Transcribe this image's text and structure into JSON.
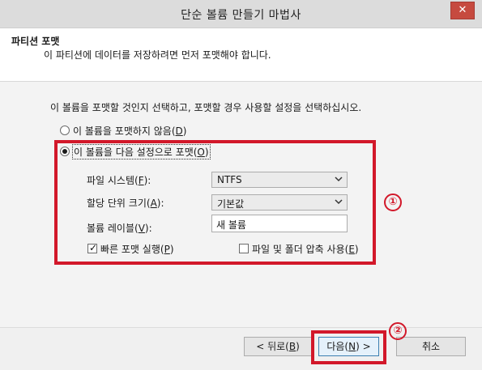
{
  "window": {
    "title": "단순 볼륨 만들기 마법사",
    "close_glyph": "✕"
  },
  "header": {
    "title": "파티션 포맷",
    "subtitle": "이 파티션에 데이터를 저장하려면 먼저 포맷해야 합니다."
  },
  "main": {
    "instruction": "이 볼륨을 포맷할 것인지 선택하고, 포맷할 경우 사용할 설정을 선택하십시오.",
    "option_no_format": {
      "label": "이 볼륨을 포맷하지 않음(",
      "key": "D",
      "tail": ")",
      "selected": false
    },
    "option_format": {
      "label": "이 볼륨을 다음 설정으로 포맷(",
      "key": "O",
      "tail": ")",
      "selected": true
    },
    "file_system": {
      "label": "파일 시스템(",
      "key": "F",
      "tail": "):",
      "value": "NTFS"
    },
    "allocation_unit": {
      "label": "할당 단위 크기(",
      "key": "A",
      "tail": "):",
      "value": "기본값"
    },
    "volume_label": {
      "label": "볼륨 레이블(",
      "key": "V",
      "tail": "):",
      "value": "새 볼륨"
    },
    "quick_format": {
      "label": "빠른 포맷 실행(",
      "key": "P",
      "tail": ")",
      "checked": true
    },
    "compression": {
      "label": "파일 및 폴더 압축 사용(",
      "key": "E",
      "tail": ")",
      "checked": false
    }
  },
  "annotations": {
    "badge1": "①",
    "badge2": "②",
    "color": "#d2182a"
  },
  "footer": {
    "back": {
      "label": "< 뒤로(",
      "key": "B",
      "tail": ")"
    },
    "next": {
      "label": "다음(",
      "key": "N",
      "tail": ") >"
    },
    "cancel": {
      "label": "취소"
    }
  }
}
